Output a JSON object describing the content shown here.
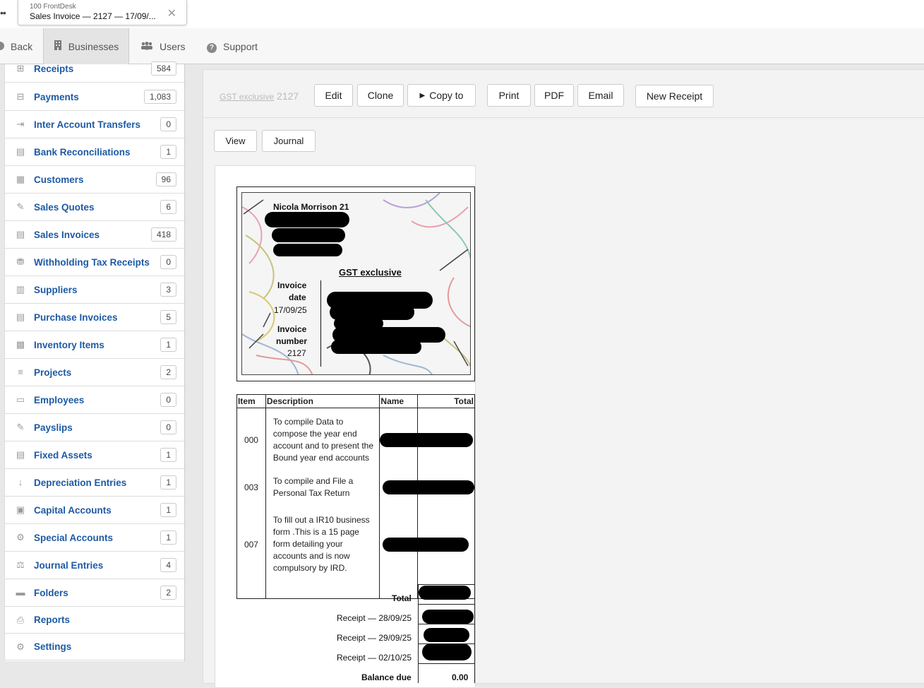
{
  "browser_tab": {
    "sub": "100 FrontDesk",
    "title": "Sales Invoice — 2127 — 17/09/...",
    "close": "✕"
  },
  "nav": {
    "back": "Back",
    "businesses": "Businesses",
    "users": "Users",
    "support": "Support"
  },
  "sidebar": {
    "items": [
      {
        "label": "Receipts",
        "count": "584",
        "icon": "plus-square-icon"
      },
      {
        "label": "Payments",
        "count": "1,083",
        "icon": "minus-square-icon"
      },
      {
        "label": "Inter Account Transfers",
        "count": "0",
        "icon": "transfer-icon"
      },
      {
        "label": "Bank Reconciliations",
        "count": "1",
        "icon": "clipboard-check-icon"
      },
      {
        "label": "Customers",
        "count": "96",
        "icon": "grid-icon"
      },
      {
        "label": "Sales Quotes",
        "count": "6",
        "icon": "quote-icon"
      },
      {
        "label": "Sales Invoices",
        "count": "418",
        "icon": "file-icon"
      },
      {
        "label": "Withholding Tax Receipts",
        "count": "0",
        "icon": "tax-icon"
      },
      {
        "label": "Suppliers",
        "count": "3",
        "icon": "building-icon"
      },
      {
        "label": "Purchase Invoices",
        "count": "5",
        "icon": "file-icon"
      },
      {
        "label": "Inventory Items",
        "count": "1",
        "icon": "inventory-icon"
      },
      {
        "label": "Projects",
        "count": "2",
        "icon": "chart-icon"
      },
      {
        "label": "Employees",
        "count": "0",
        "icon": "id-card-icon"
      },
      {
        "label": "Payslips",
        "count": "0",
        "icon": "payslip-icon"
      },
      {
        "label": "Fixed Assets",
        "count": "1",
        "icon": "asset-icon"
      },
      {
        "label": "Depreciation Entries",
        "count": "1",
        "icon": "sort-down-icon"
      },
      {
        "label": "Capital Accounts",
        "count": "1",
        "icon": "capital-icon"
      },
      {
        "label": "Special Accounts",
        "count": "1",
        "icon": "gears-icon"
      },
      {
        "label": "Journal Entries",
        "count": "4",
        "icon": "balance-scale-icon"
      },
      {
        "label": "Folders",
        "count": "2",
        "icon": "folder-icon"
      },
      {
        "label": "Reports",
        "count": "",
        "icon": "printer-icon"
      },
      {
        "label": "Settings",
        "count": "",
        "icon": "gear-icon"
      }
    ]
  },
  "toolbar": {
    "crumb_link": "GST exclusive",
    "crumb_number": "2127",
    "edit": "Edit",
    "clone": "Clone",
    "copy_to": "Copy to",
    "print": "Print",
    "pdf": "PDF",
    "email": "Email",
    "new_receipt": "New Receipt"
  },
  "view_tabs": {
    "view": "View",
    "journal": "Journal"
  },
  "invoice": {
    "customer_name": "Nicola Morrison 21",
    "title": "GST exclusive",
    "date_label_1": "Invoice",
    "date_label_2": "date",
    "date_value": "17/09/25",
    "number_label_1": "Invoice",
    "number_label_2": "number",
    "number_value": "2127",
    "columns": {
      "item": "Item",
      "description": "Description",
      "name": "Name",
      "total": "Total"
    },
    "lines": [
      {
        "item": "000",
        "description": "To compile Data to compose the year end account and to present the Bound year end accounts"
      },
      {
        "item": "003",
        "description": "To compile and File a Personal Tax Return"
      },
      {
        "item": "007",
        "description": "To fill out a IR10 business form .This is a 15 page form detailing your accounts and is now compulsory by IRD."
      }
    ],
    "total_label": "Total",
    "receipts": [
      "Receipt — 28/09/25",
      "Receipt — 29/09/25",
      "Receipt — 02/10/25"
    ],
    "balance_label": "Balance due",
    "balance_value": "0.00"
  }
}
